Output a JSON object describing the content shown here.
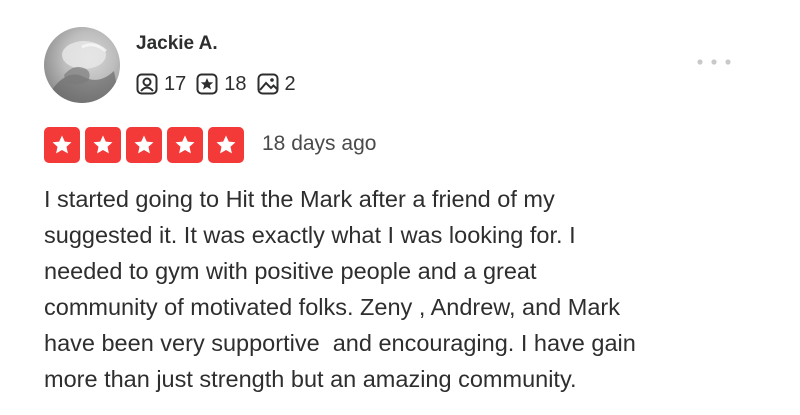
{
  "review": {
    "user": {
      "name": "Jackie A.",
      "stats": [
        {
          "icon": "friends-icon",
          "value": "17"
        },
        {
          "icon": "reviews-star-icon",
          "value": "18"
        },
        {
          "icon": "photos-icon",
          "value": "2"
        }
      ]
    },
    "rating": 5,
    "rating_max": 5,
    "date": "18 days ago",
    "text_lines": [
      "I started going to Hit the Mark after a friend of my",
      "suggested it. It was exactly what I was looking for. I",
      "needed to gym with positive people and a great",
      "community of motivated folks. Zeny , Andrew, and Mark",
      "have been very supportive  and encouraging. I have gain",
      "more than just strength but an amazing community."
    ]
  },
  "colors": {
    "star_fill": "#f43939",
    "text": "#2d2e2f",
    "muted": "#c8c9ca"
  }
}
